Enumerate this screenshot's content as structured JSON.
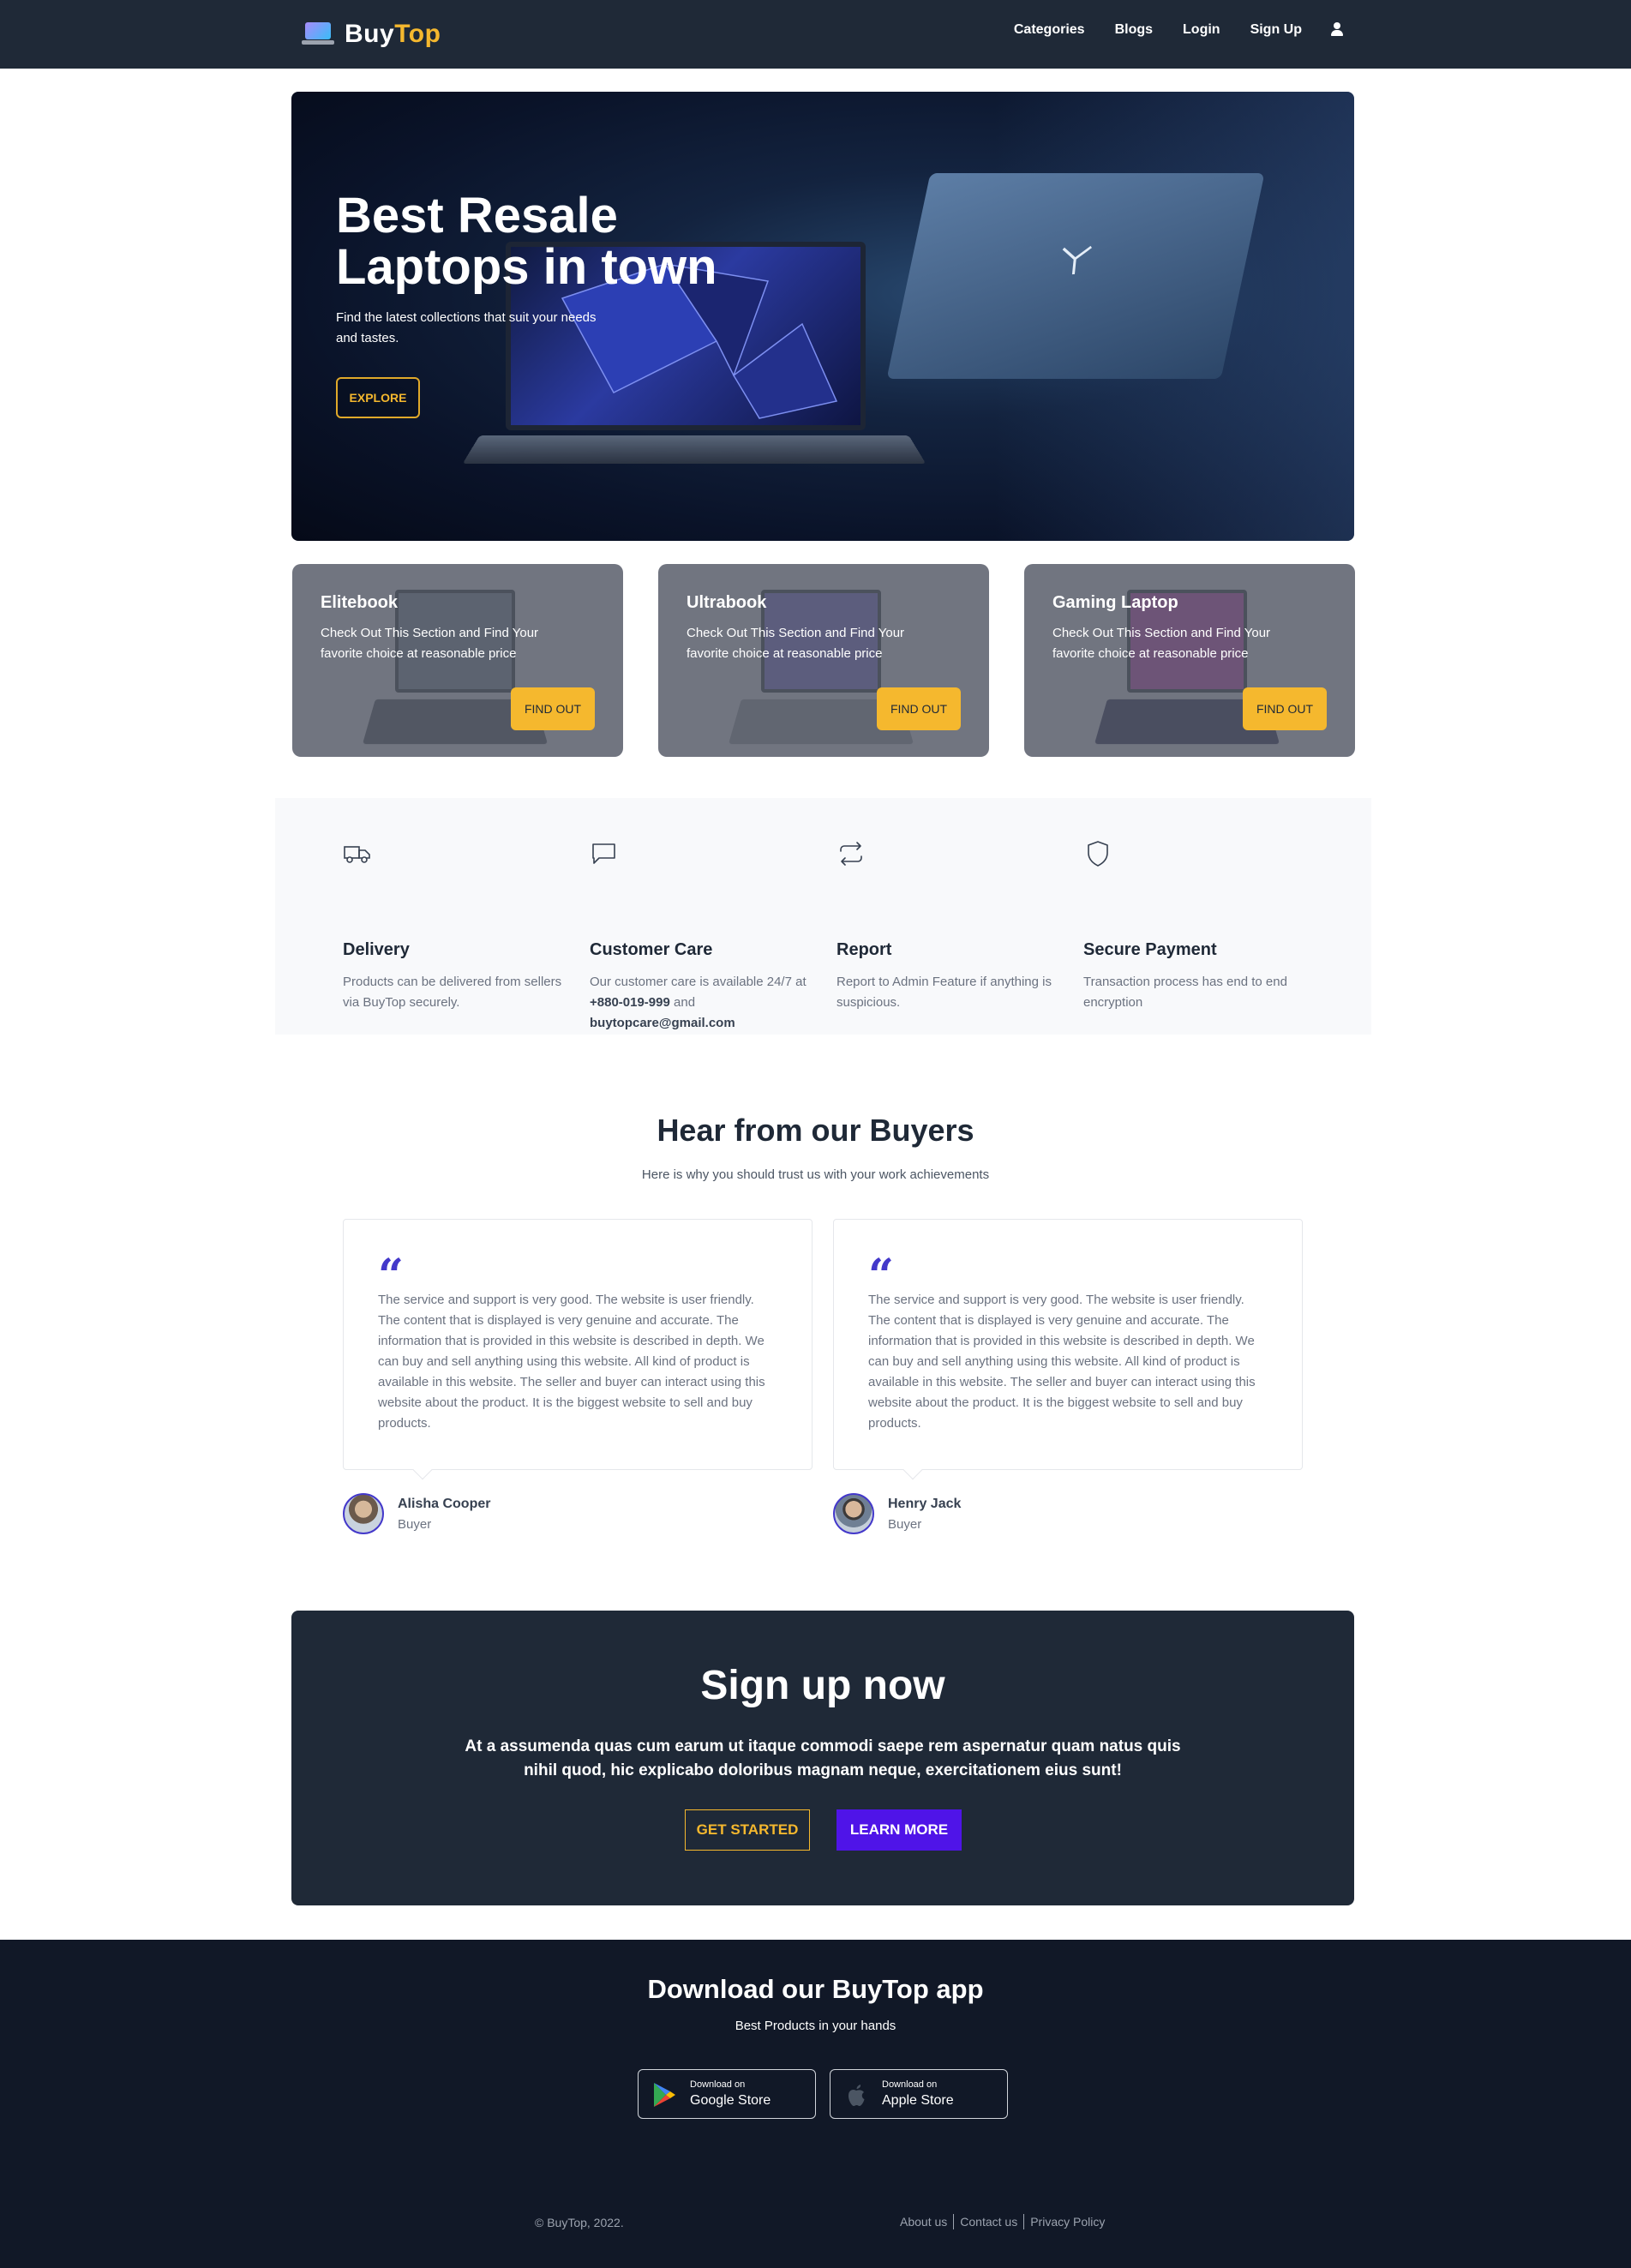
{
  "brand": {
    "name_prefix": "Buy",
    "name_suffix": "Top",
    "accent_color": "#f5b82e"
  },
  "nav": {
    "items": [
      {
        "label": "Categories"
      },
      {
        "label": "Blogs"
      },
      {
        "label": "Login"
      },
      {
        "label": "Sign Up"
      }
    ],
    "user_icon": "user-icon"
  },
  "hero": {
    "title": "Best Resale Laptops in town",
    "subtitle": "Find the latest collections that suit your needs and tastes.",
    "cta_label": "EXPLORE"
  },
  "categories": [
    {
      "title": "Elitebook",
      "description": "Check Out This Section and Find Your favorite choice at reasonable price",
      "button_label": "FIND OUT"
    },
    {
      "title": "Ultrabook",
      "description": "Check Out This Section and Find Your favorite choice at reasonable price",
      "button_label": "FIND OUT"
    },
    {
      "title": "Gaming Laptop",
      "description": "Check Out This Section and Find Your favorite choice at reasonable price",
      "button_label": "FIND OUT"
    }
  ],
  "features": [
    {
      "icon": "truck-icon",
      "title": "Delivery",
      "description": "Products can be delivered from sellers via BuyTop securely."
    },
    {
      "icon": "chat-icon",
      "title": "Customer Care",
      "description_prefix": "Our customer care is available 24/7 at ",
      "phone": "+880-019-999",
      "description_mid": " and ",
      "email": "buytopcare@gmail.com"
    },
    {
      "icon": "repeat-icon",
      "title": "Report",
      "description": "Report to Admin Feature if anything is suspicious."
    },
    {
      "icon": "shield-icon",
      "title": "Secure Payment",
      "description": "Transaction process has end to end encryption"
    }
  ],
  "testimonials": {
    "title": "Hear from our Buyers",
    "subtitle": "Here is why you should trust us with your work achievements",
    "items": [
      {
        "text": "The service and support is very good. The website is user friendly. The content that is displayed is very genuine and accurate. The information that is provided in this website is described in depth. We can buy and sell anything using this website. All kind of product is available in this website. The seller and buyer can interact using this website about the product. It is the biggest website to sell and buy products.",
        "author": "Alisha Cooper",
        "role": "Buyer"
      },
      {
        "text": "The service and support is very good. The website is user friendly. The content that is displayed is very genuine and accurate. The information that is provided in this website is described in depth. We can buy and sell anything using this website. All kind of product is available in this website. The seller and buyer can interact using this website about the product. It is the biggest website to sell and buy products.",
        "author": "Henry Jack",
        "role": "Buyer"
      }
    ]
  },
  "signup": {
    "title": "Sign up now",
    "text": "At a assumenda quas cum earum ut itaque commodi saepe rem aspernatur quam natus quis nihil quod, hic explicabo doloribus magnam neque, exercitationem eius sunt!",
    "get_started_label": "GET STARTED",
    "learn_more_label": "LEARN MORE"
  },
  "footer": {
    "app_title": "Download our BuyTop app",
    "app_subtitle": "Best Products in your hands",
    "stores": [
      {
        "small": "Download on",
        "big": "Google Store",
        "icon": "google-play-icon"
      },
      {
        "small": "Download on",
        "big": "Apple Store",
        "icon": "apple-icon"
      }
    ],
    "copyright": "© BuyTop, 2022.",
    "links": [
      {
        "label": "About us"
      },
      {
        "label": "Contact us"
      },
      {
        "label": "Privacy Policy"
      }
    ]
  }
}
